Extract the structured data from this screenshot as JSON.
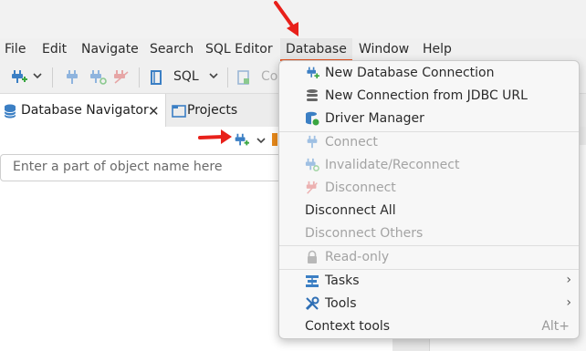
{
  "menubar": {
    "items": [
      "File",
      "Edit",
      "Navigate",
      "Search",
      "SQL Editor",
      "Database",
      "Window",
      "Help"
    ],
    "active": "Database"
  },
  "toolbar": {
    "sql_label": "SQL",
    "truncated_label": "Co"
  },
  "tabs": [
    {
      "label": "Database Navigator",
      "active": true
    },
    {
      "label": "Projects",
      "active": false
    }
  ],
  "navigator": {
    "filter_placeholder": "Enter a part of object name here"
  },
  "database_menu": {
    "items": [
      {
        "label": "New Database Connection",
        "icon": "plug-plus-icon",
        "enabled": true
      },
      {
        "label": "New Connection from JDBC URL",
        "icon": "database-stack-icon",
        "enabled": true
      },
      {
        "label": "Driver Manager",
        "icon": "driver-manager-icon",
        "enabled": true
      },
      {
        "label": "Connect",
        "icon": "plug-icon",
        "enabled": false
      },
      {
        "label": "Invalidate/Reconnect",
        "icon": "plug-refresh-icon",
        "enabled": false
      },
      {
        "label": "Disconnect",
        "icon": "plug-disconnect-icon",
        "enabled": false
      },
      {
        "label": "Disconnect All",
        "enabled": true
      },
      {
        "label": "Disconnect Others",
        "enabled": false
      },
      {
        "label": "Read-only",
        "icon": "lock-icon",
        "enabled": false
      },
      {
        "label": "Tasks",
        "icon": "tasks-icon",
        "enabled": true,
        "submenu": true
      },
      {
        "label": "Tools",
        "icon": "tools-icon",
        "enabled": true,
        "submenu": true
      },
      {
        "label": "Context tools",
        "enabled": true,
        "accelerator": "Alt+"
      }
    ]
  },
  "colors": {
    "accent": "#e95420",
    "plug_blue": "#3b7fc4",
    "plug_green": "#3aa541",
    "annotation_red": "#e8201a"
  }
}
